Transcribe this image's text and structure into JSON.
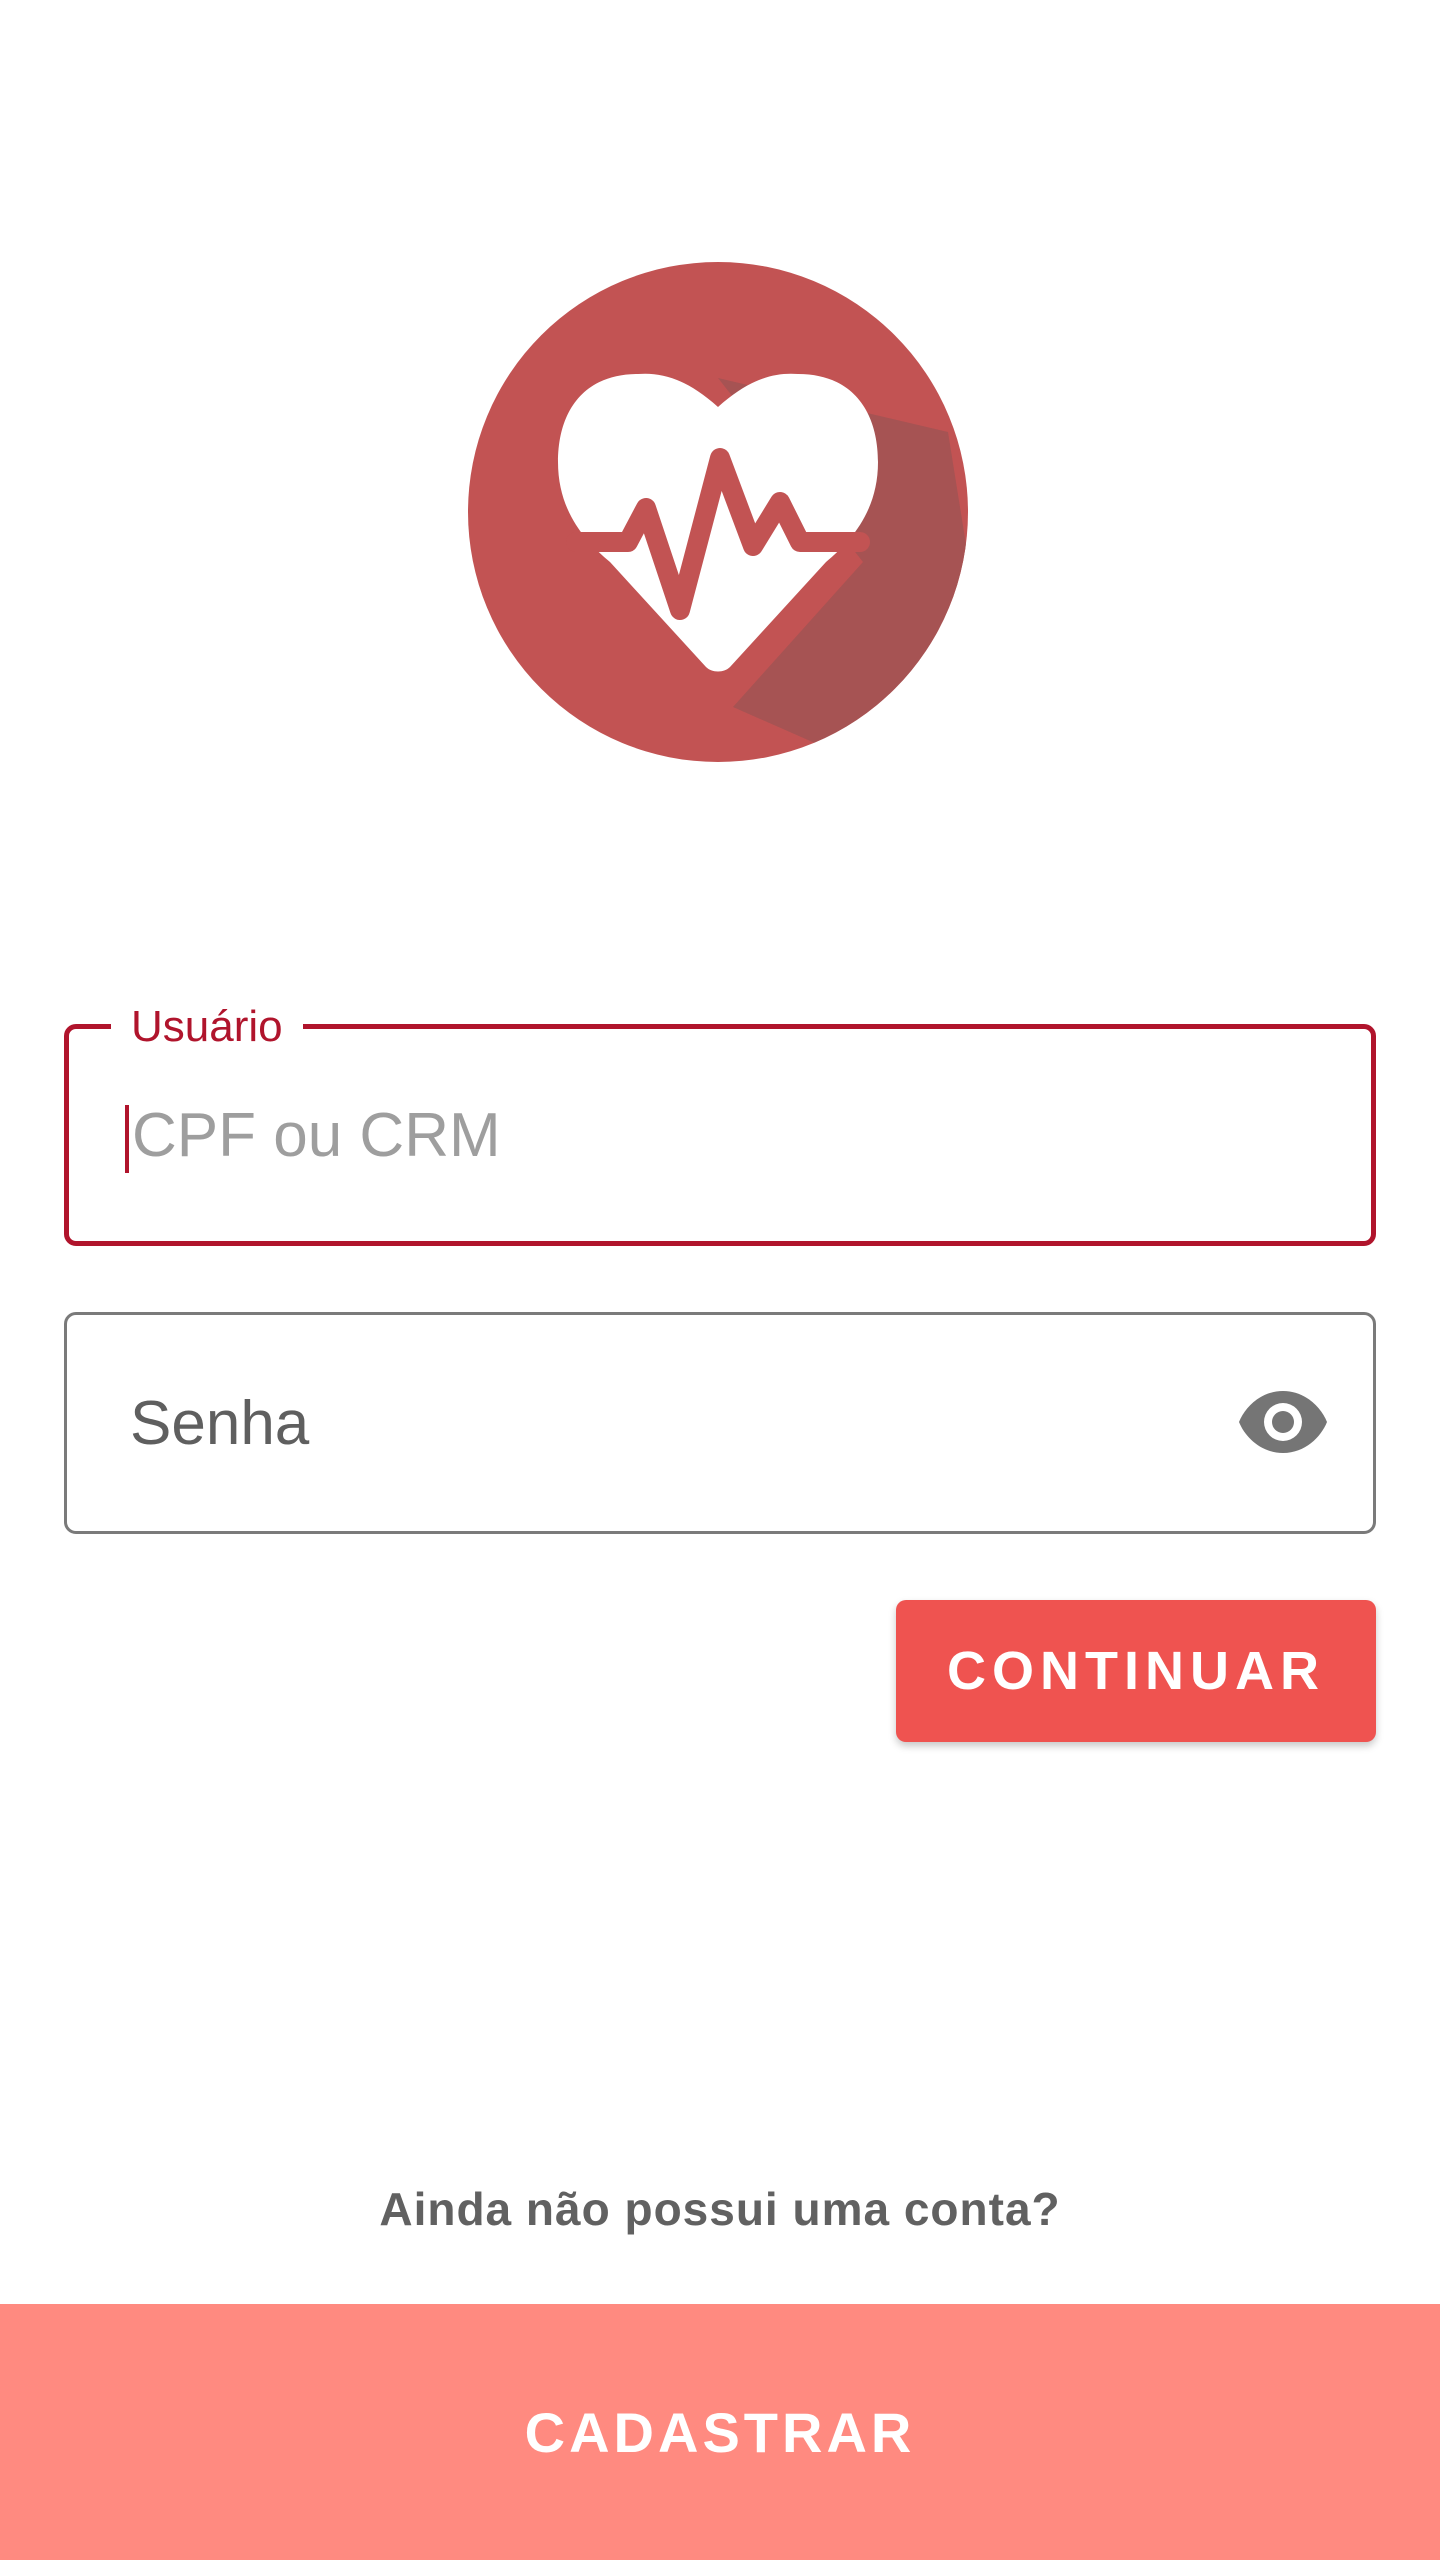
{
  "logo": {
    "icon": "heart-pulse-icon",
    "circle_color": "#c25353",
    "shadow_color": "#a65353"
  },
  "login": {
    "user_field": {
      "label": "Usuário",
      "placeholder": "CPF ou CRM",
      "value": ""
    },
    "password_field": {
      "placeholder": "Senha",
      "value": "",
      "toggle_icon": "eye-icon"
    },
    "continue_label": "CONTINUAR"
  },
  "signup": {
    "prompt": "Ainda não possui uma conta?",
    "button_label": "CADASTRAR"
  },
  "colors": {
    "accent": "#b0142c",
    "button": "#ef5350",
    "signup_bar": "#ff8a80"
  }
}
